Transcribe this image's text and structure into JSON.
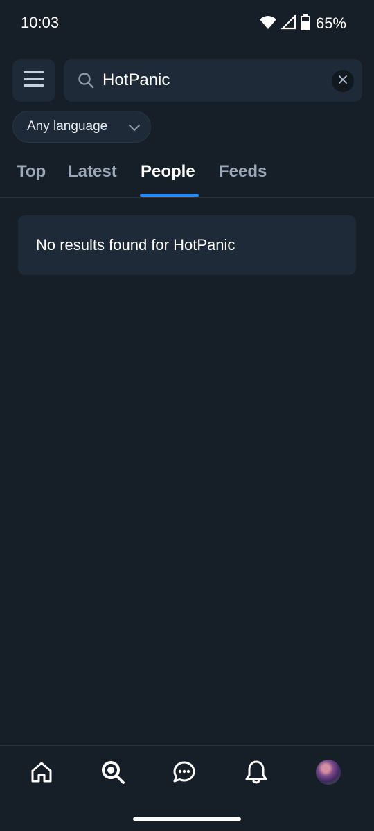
{
  "status_bar": {
    "time": "10:03",
    "battery": "65%",
    "icons": [
      "wifi-icon",
      "cell-signal-icon",
      "battery-icon"
    ]
  },
  "header": {
    "menu_icon": "hamburger-menu-icon",
    "search": {
      "value": "HotPanic",
      "icon": "search-icon",
      "clear_icon": "close-icon"
    }
  },
  "filters": {
    "language": "Any language",
    "language_icon": "chevron-down-icon"
  },
  "tabs": [
    {
      "label": "Top",
      "active": false
    },
    {
      "label": "Latest",
      "active": false
    },
    {
      "label": "People",
      "active": true
    },
    {
      "label": "Feeds",
      "active": false
    }
  ],
  "results": {
    "empty_message": "No results found for HotPanic"
  },
  "bottom_nav": {
    "items": [
      "home-icon",
      "search-icon",
      "chat-icon",
      "notifications-bell-icon",
      "profile-avatar"
    ],
    "active": "search-icon"
  },
  "colors": {
    "background": "#161e27",
    "surface": "#1e2a37",
    "accent": "#208bfe",
    "muted_text": "#9aa8b8"
  }
}
